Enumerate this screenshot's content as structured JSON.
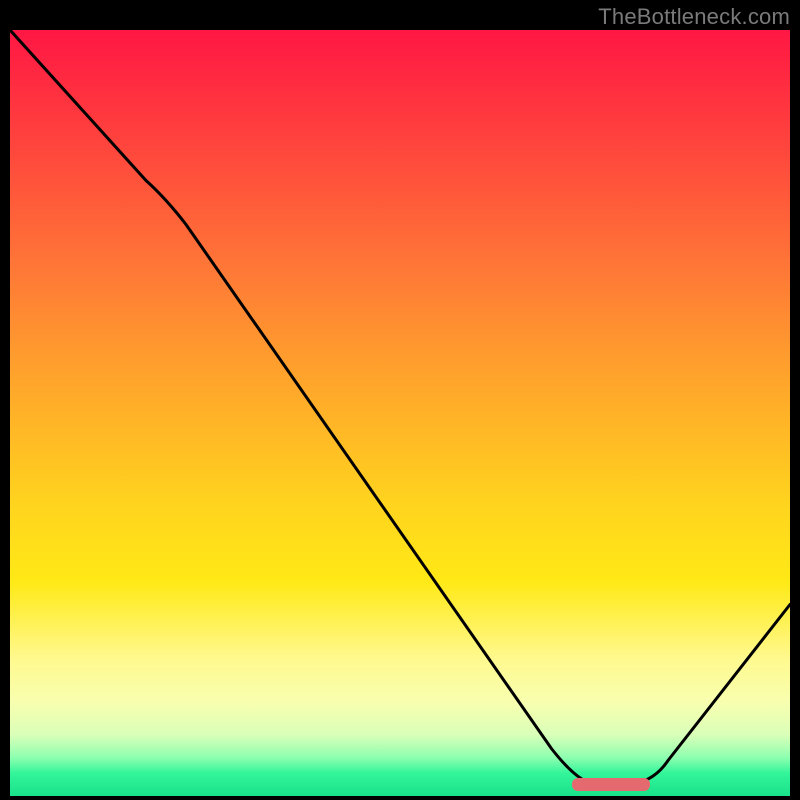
{
  "watermark": "TheBottleneck.com",
  "chart_data": {
    "type": "line",
    "title": "",
    "xlabel": "",
    "ylabel": "",
    "xlim": [
      0,
      100
    ],
    "ylim": [
      0,
      100
    ],
    "x": [
      0,
      20,
      73,
      80,
      100
    ],
    "values": [
      100,
      78,
      1.5,
      1.5,
      25
    ],
    "optimum_marker": {
      "x_start": 72,
      "x_end": 82,
      "y": 1.5
    },
    "background": "rainbow-vertical-red-to-green",
    "grid": false,
    "legend": false
  },
  "colors": {
    "line": "#000000",
    "marker": "#e46a6f",
    "frame": "#000000"
  }
}
